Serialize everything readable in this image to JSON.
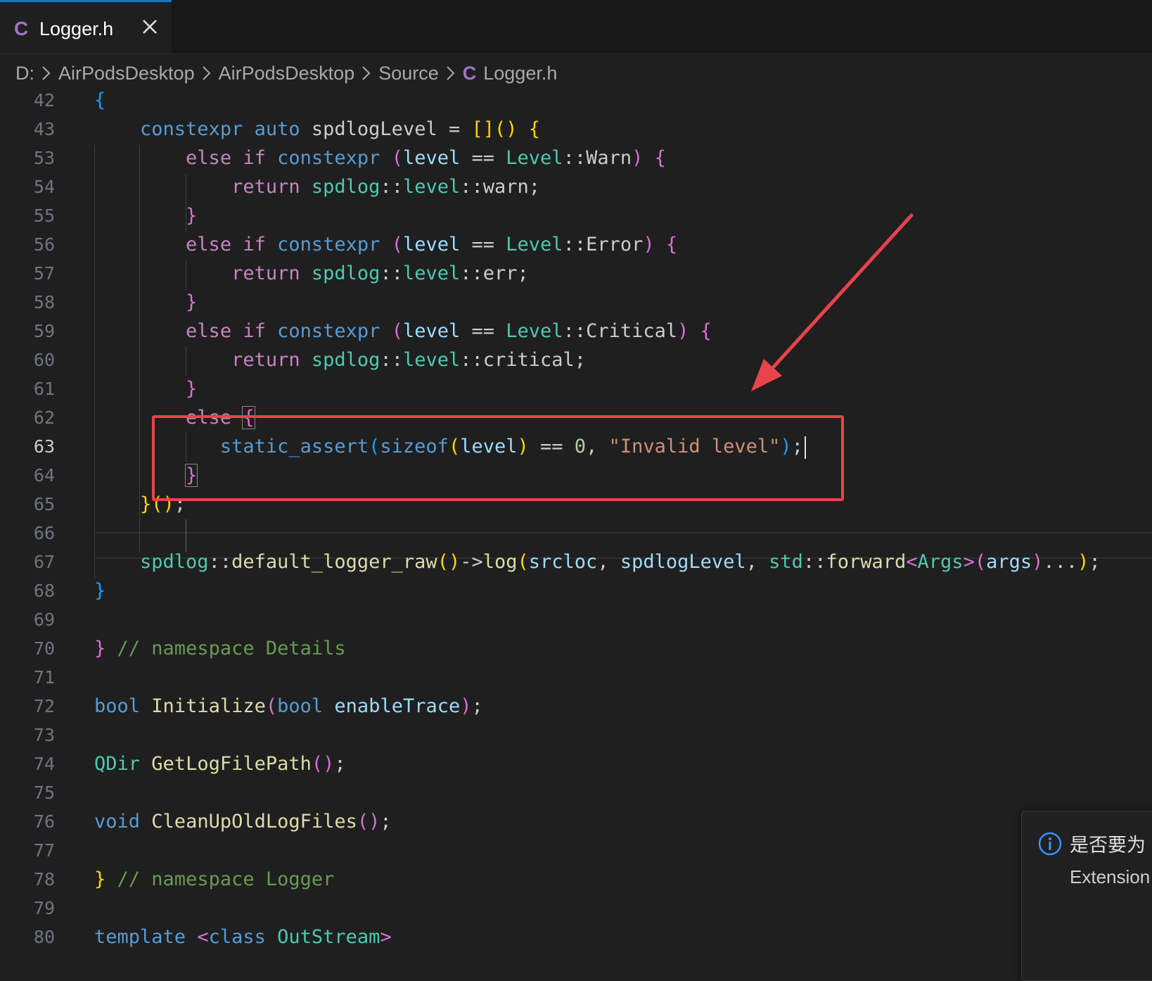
{
  "tab": {
    "lang_glyph": "C",
    "filename": "Logger.h"
  },
  "breadcrumb": [
    "D:",
    "AirPodsDesktop",
    "AirPodsDesktop",
    "Source",
    "Logger.h"
  ],
  "breadcrumb_file_glyph": "C",
  "editor": {
    "active_line": 63,
    "lines": [
      {
        "n": "42",
        "t": [
          [
            "b3",
            "{"
          ]
        ]
      },
      {
        "n": "43",
        "t": [
          [
            "",
            "    "
          ],
          [
            "kw",
            "constexpr"
          ],
          [
            "",
            " "
          ],
          [
            "kw",
            "auto"
          ],
          [
            "",
            " spdlogLevel = "
          ],
          [
            "b1",
            "[]"
          ],
          [
            "b1",
            "()"
          ],
          [
            "",
            " "
          ],
          [
            "b1",
            "{"
          ]
        ]
      },
      {
        "n": "53",
        "t": [
          [
            "",
            "        "
          ],
          [
            "ctl",
            "else"
          ],
          [
            "",
            " "
          ],
          [
            "ctl",
            "if"
          ],
          [
            "",
            " "
          ],
          [
            "kw",
            "constexpr"
          ],
          [
            "",
            " "
          ],
          [
            "b2",
            "("
          ],
          [
            "var",
            "level"
          ],
          [
            "",
            " == "
          ],
          [
            "ty",
            "Level"
          ],
          [
            "",
            "::Warn"
          ],
          [
            "b2",
            ")"
          ],
          [
            "",
            " "
          ],
          [
            "b2",
            "{"
          ]
        ]
      },
      {
        "n": "54",
        "t": [
          [
            "",
            "            "
          ],
          [
            "ctl",
            "return"
          ],
          [
            "",
            " "
          ],
          [
            "ty",
            "spdlog"
          ],
          [
            "",
            "::"
          ],
          [
            "ty",
            "level"
          ],
          [
            "",
            "::warn;"
          ]
        ]
      },
      {
        "n": "55",
        "t": [
          [
            "",
            "        "
          ],
          [
            "b2",
            "}"
          ]
        ]
      },
      {
        "n": "56",
        "t": [
          [
            "",
            "        "
          ],
          [
            "ctl",
            "else"
          ],
          [
            "",
            " "
          ],
          [
            "ctl",
            "if"
          ],
          [
            "",
            " "
          ],
          [
            "kw",
            "constexpr"
          ],
          [
            "",
            " "
          ],
          [
            "b2",
            "("
          ],
          [
            "var",
            "level"
          ],
          [
            "",
            " == "
          ],
          [
            "ty",
            "Level"
          ],
          [
            "",
            "::Error"
          ],
          [
            "b2",
            ")"
          ],
          [
            "",
            " "
          ],
          [
            "b2",
            "{"
          ]
        ]
      },
      {
        "n": "57",
        "t": [
          [
            "",
            "            "
          ],
          [
            "ctl",
            "return"
          ],
          [
            "",
            " "
          ],
          [
            "ty",
            "spdlog"
          ],
          [
            "",
            "::"
          ],
          [
            "ty",
            "level"
          ],
          [
            "",
            "::err;"
          ]
        ]
      },
      {
        "n": "58",
        "t": [
          [
            "",
            "        "
          ],
          [
            "b2",
            "}"
          ]
        ]
      },
      {
        "n": "59",
        "t": [
          [
            "",
            "        "
          ],
          [
            "ctl",
            "else"
          ],
          [
            "",
            " "
          ],
          [
            "ctl",
            "if"
          ],
          [
            "",
            " "
          ],
          [
            "kw",
            "constexpr"
          ],
          [
            "",
            " "
          ],
          [
            "b2",
            "("
          ],
          [
            "var",
            "level"
          ],
          [
            "",
            " == "
          ],
          [
            "ty",
            "Level"
          ],
          [
            "",
            "::Critical"
          ],
          [
            "b2",
            ")"
          ],
          [
            "",
            " "
          ],
          [
            "b2",
            "{"
          ]
        ]
      },
      {
        "n": "60",
        "t": [
          [
            "",
            "            "
          ],
          [
            "ctl",
            "return"
          ],
          [
            "",
            " "
          ],
          [
            "ty",
            "spdlog"
          ],
          [
            "",
            "::"
          ],
          [
            "ty",
            "level"
          ],
          [
            "",
            "::critical;"
          ]
        ]
      },
      {
        "n": "61",
        "t": [
          [
            "",
            "        "
          ],
          [
            "b2",
            "}"
          ]
        ]
      },
      {
        "n": "62",
        "t": [
          [
            "",
            "        "
          ],
          [
            "ctl",
            "else"
          ],
          [
            "",
            " "
          ],
          [
            "b2 bm",
            "{"
          ]
        ]
      },
      {
        "n": "63",
        "t": [
          [
            "",
            "           "
          ],
          [
            "kw",
            "static_assert"
          ],
          [
            "b3",
            "("
          ],
          [
            "kw",
            "sizeof"
          ],
          [
            "b1",
            "("
          ],
          [
            "var",
            "level"
          ],
          [
            "b1",
            ")"
          ],
          [
            "",
            " == "
          ],
          [
            "num",
            "0"
          ],
          [
            "",
            ", "
          ],
          [
            "str",
            "\"Invalid level\""
          ],
          [
            "b3",
            ")"
          ],
          [
            "",
            ";"
          ]
        ]
      },
      {
        "n": "64",
        "t": [
          [
            "",
            "        "
          ],
          [
            "b2 bm",
            "}"
          ]
        ]
      },
      {
        "n": "65",
        "t": [
          [
            "",
            "    "
          ],
          [
            "b1",
            "}"
          ],
          [
            "b1",
            "()"
          ],
          [
            "",
            ";"
          ]
        ]
      },
      {
        "n": "66",
        "t": []
      },
      {
        "n": "67",
        "t": [
          [
            "",
            "    "
          ],
          [
            "ty",
            "spdlog"
          ],
          [
            "",
            "::"
          ],
          [
            "fn",
            "default_logger_raw"
          ],
          [
            "b1",
            "()"
          ],
          [
            "",
            "->"
          ],
          [
            "fn",
            "log"
          ],
          [
            "b1",
            "("
          ],
          [
            "var",
            "srcloc"
          ],
          [
            "",
            ", "
          ],
          [
            "var",
            "spdlogLevel"
          ],
          [
            "",
            ", "
          ],
          [
            "ty",
            "std"
          ],
          [
            "",
            "::"
          ],
          [
            "fn",
            "forward"
          ],
          [
            "b2",
            "<"
          ],
          [
            "ty",
            "Args"
          ],
          [
            "b2",
            ">"
          ],
          [
            "b2",
            "("
          ],
          [
            "var",
            "args"
          ],
          [
            "b2",
            ")"
          ],
          [
            "",
            "..."
          ],
          [
            "b1",
            ")"
          ],
          [
            "",
            ";"
          ]
        ]
      },
      {
        "n": "68",
        "t": [
          [
            "b3",
            "}"
          ]
        ]
      },
      {
        "n": "69",
        "t": []
      },
      {
        "n": "70",
        "t": [
          [
            "b2",
            "}"
          ],
          [
            "",
            " "
          ],
          [
            "com",
            "// namespace Details"
          ]
        ]
      },
      {
        "n": "71",
        "t": []
      },
      {
        "n": "72",
        "t": [
          [
            "kw",
            "bool"
          ],
          [
            "",
            " "
          ],
          [
            "fn",
            "Initialize"
          ],
          [
            "b2",
            "("
          ],
          [
            "kw",
            "bool"
          ],
          [
            "",
            " "
          ],
          [
            "var",
            "enableTrace"
          ],
          [
            "b2",
            ")"
          ],
          [
            "",
            ";"
          ]
        ]
      },
      {
        "n": "73",
        "t": []
      },
      {
        "n": "74",
        "t": [
          [
            "ty",
            "QDir"
          ],
          [
            "",
            " "
          ],
          [
            "fn",
            "GetLogFilePath"
          ],
          [
            "b2",
            "()"
          ],
          [
            "",
            ";"
          ]
        ]
      },
      {
        "n": "75",
        "t": []
      },
      {
        "n": "76",
        "t": [
          [
            "kw",
            "void"
          ],
          [
            "",
            " "
          ],
          [
            "fn",
            "CleanUpOldLogFiles"
          ],
          [
            "b2",
            "()"
          ],
          [
            "",
            ";"
          ]
        ]
      },
      {
        "n": "77",
        "t": []
      },
      {
        "n": "78",
        "t": [
          [
            "b1",
            "}"
          ],
          [
            "",
            " "
          ],
          [
            "com",
            "// namespace Logger"
          ]
        ]
      },
      {
        "n": "79",
        "t": []
      },
      {
        "n": "80",
        "t": [
          [
            "kw",
            "template"
          ],
          [
            "",
            " "
          ],
          [
            "b2",
            "<"
          ],
          [
            "kw",
            "class"
          ],
          [
            "",
            " "
          ],
          [
            "ty",
            "OutStream"
          ],
          [
            "b2",
            ">"
          ]
        ]
      }
    ]
  },
  "notification": {
    "title": "是否要为",
    "body": "Extension"
  },
  "colors": {
    "accent": "#0078d4",
    "annotation_red": "#e8434a"
  }
}
